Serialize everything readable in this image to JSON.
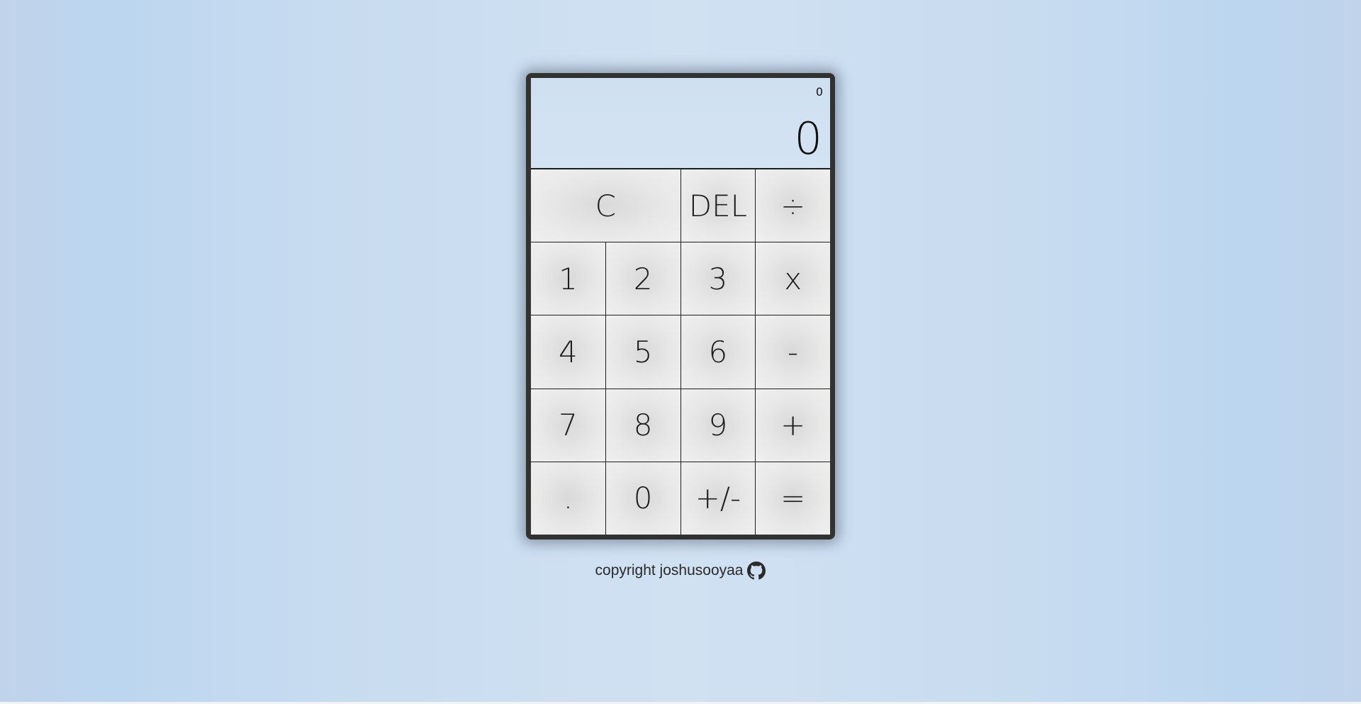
{
  "calculator": {
    "previous_operand": "0",
    "current_operand": "0",
    "keys": {
      "clear": "C",
      "delete": "DEL",
      "divide": "÷",
      "one": "1",
      "two": "2",
      "three": "3",
      "multiply": "x",
      "four": "4",
      "five": "5",
      "six": "6",
      "subtract": "-",
      "seven": "7",
      "eight": "8",
      "nine": "9",
      "add": "+",
      "decimal": ".",
      "zero": "0",
      "negate": "+/-",
      "equals": "="
    }
  },
  "footer": {
    "copyright_text": "copyright joshusooyaa",
    "icon": "github-icon"
  },
  "colors": {
    "calculator_frame": "#323232",
    "display_background": "#cfe0f1",
    "key_background": "#e8e8e8",
    "page_background": "#c8dcf0"
  }
}
